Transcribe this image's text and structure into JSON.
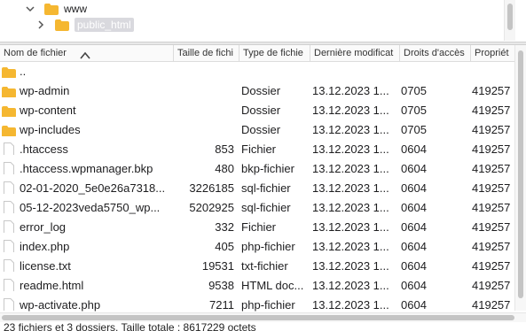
{
  "tree": {
    "items": [
      {
        "label": "www",
        "expanded": true
      },
      {
        "label": "public_html",
        "expanded": false,
        "selected": true
      }
    ]
  },
  "columns": [
    "Nom de fichier",
    "Taille de fichi",
    "Type de fichie",
    "Dernière modificat",
    "Droits d'accès",
    "Propriét"
  ],
  "sort": {
    "column": "Nom de fichier",
    "direction": "ascending"
  },
  "rows": [
    {
      "icon": "folder-icon",
      "name": "..",
      "size": "",
      "type": "",
      "date": "",
      "perm": "",
      "owner": ""
    },
    {
      "icon": "folder-icon",
      "name": "wp-admin",
      "size": "",
      "type": "Dossier",
      "date": "13.12.2023 1...",
      "perm": "0705",
      "owner": "419257"
    },
    {
      "icon": "folder-icon",
      "name": "wp-content",
      "size": "",
      "type": "Dossier",
      "date": "13.12.2023 1...",
      "perm": "0705",
      "owner": "419257"
    },
    {
      "icon": "folder-icon",
      "name": "wp-includes",
      "size": "",
      "type": "Dossier",
      "date": "13.12.2023 1...",
      "perm": "0705",
      "owner": "419257"
    },
    {
      "icon": "file-icon",
      "name": ".htaccess",
      "size": "853",
      "type": "Fichier",
      "date": "13.12.2023 1...",
      "perm": "0604",
      "owner": "419257"
    },
    {
      "icon": "file-icon",
      "name": ".htaccess.wpmanager.bkp",
      "size": "480",
      "type": "bkp-fichier",
      "date": "13.12.2023 1...",
      "perm": "0604",
      "owner": "419257"
    },
    {
      "icon": "file-icon",
      "name": "02-01-2020_5e0e26a7318...",
      "size": "3226185",
      "type": "sql-fichier",
      "date": "13.12.2023 1...",
      "perm": "0604",
      "owner": "419257"
    },
    {
      "icon": "file-icon",
      "name": "05-12-2023veda5750_wp...",
      "size": "5202925",
      "type": "sql-fichier",
      "date": "13.12.2023 1...",
      "perm": "0604",
      "owner": "419257"
    },
    {
      "icon": "file-icon",
      "name": "error_log",
      "size": "332",
      "type": "Fichier",
      "date": "13.12.2023 1...",
      "perm": "0604",
      "owner": "419257"
    },
    {
      "icon": "file-icon",
      "name": "index.php",
      "size": "405",
      "type": "php-fichier",
      "date": "13.12.2023 1...",
      "perm": "0604",
      "owner": "419257"
    },
    {
      "icon": "file-icon",
      "name": "license.txt",
      "size": "19531",
      "type": "txt-fichier",
      "date": "13.12.2023 1...",
      "perm": "0604",
      "owner": "419257"
    },
    {
      "icon": "file-icon",
      "name": "readme.html",
      "size": "9538",
      "type": "HTML doc...",
      "date": "13.12.2023 1...",
      "perm": "0604",
      "owner": "419257"
    },
    {
      "icon": "file-icon",
      "name": "wp-activate.php",
      "size": "7211",
      "type": "php-fichier",
      "date": "13.12.2023 1...",
      "perm": "0604",
      "owner": "419257"
    }
  ],
  "status": "23 fichiers et 3 dossiers. Taille totale : 8617229 octets",
  "colors": {
    "folder": "#f5b731",
    "selection": "#d9d9de",
    "scrollbar": "#c4c4c4"
  }
}
